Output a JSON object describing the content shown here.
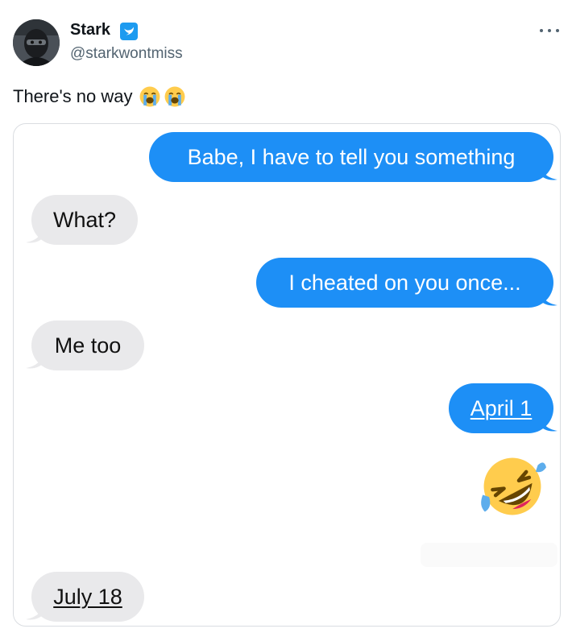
{
  "author": {
    "name": "Stark",
    "handle": "@starkwontmiss"
  },
  "tweet": {
    "text": "There's no way",
    "inline_emojis": [
      "loudly-crying-face-icon",
      "loudly-crying-face-icon"
    ]
  },
  "colors": {
    "sent_bubble": "#1d8ff6",
    "received_bubble": "#e9e9eb",
    "verified_badge": "#1d9bf0"
  },
  "messages": [
    {
      "side": "sent",
      "text": "Babe, I have to tell you something"
    },
    {
      "side": "received",
      "text": "What?"
    },
    {
      "side": "sent",
      "text": "I cheated on you once..."
    },
    {
      "side": "received",
      "text": "Me too"
    },
    {
      "side": "sent",
      "text": "April 1"
    },
    {
      "side": "sent",
      "emoji": "rolling-on-the-floor-laughing-icon"
    },
    {
      "side": "received",
      "text": "July 18"
    }
  ]
}
